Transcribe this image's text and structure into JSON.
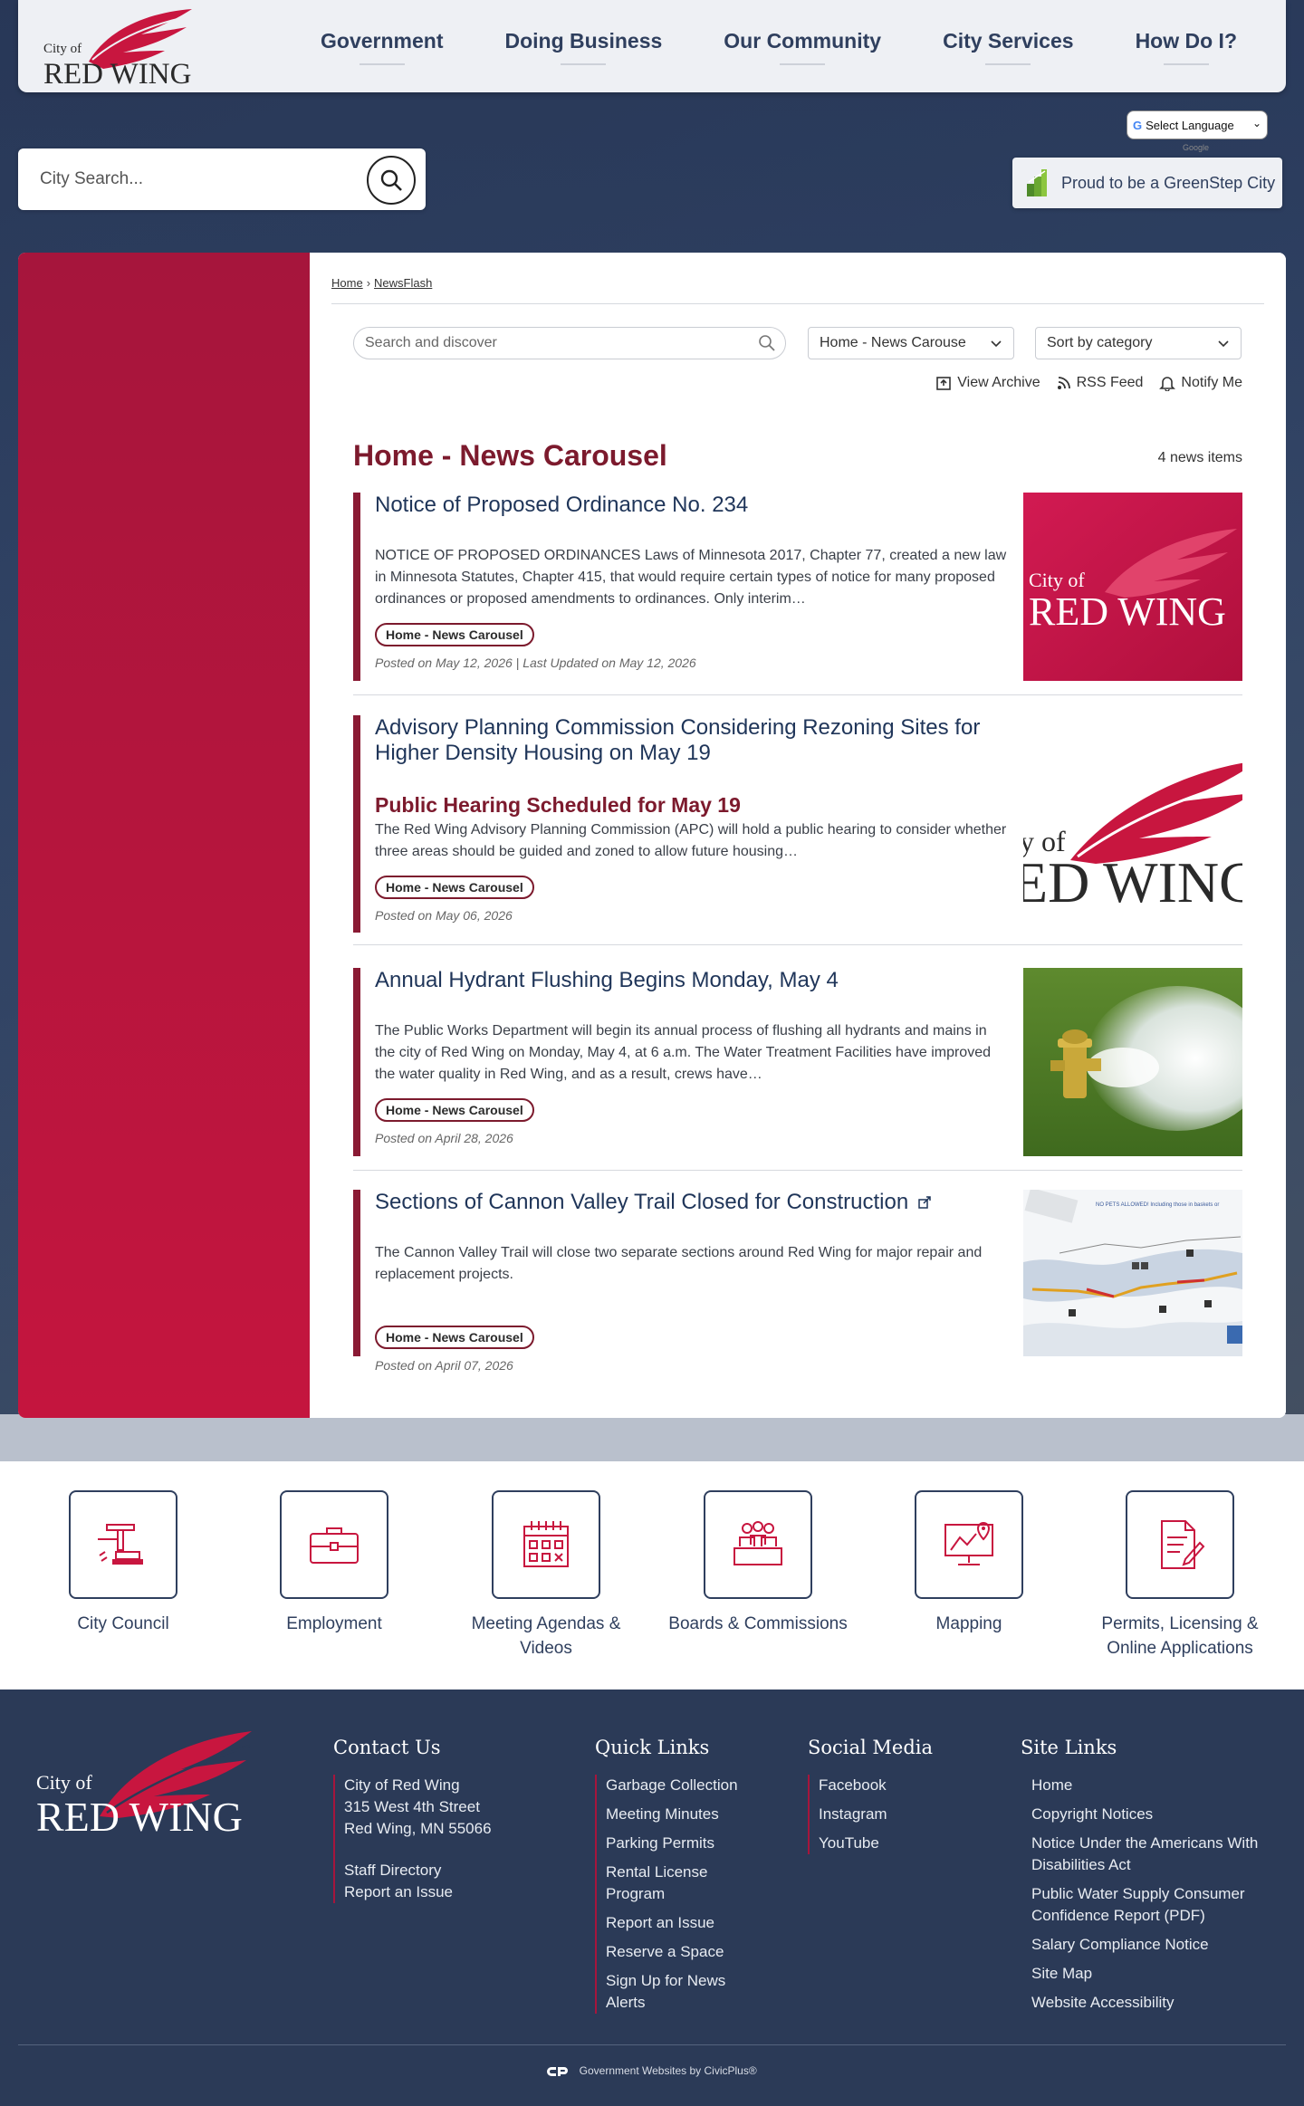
{
  "header": {
    "logo_text_small": "City of",
    "logo_text_large": "RED WING",
    "nav": [
      "Government",
      "Doing Business",
      "Our Community",
      "City Services",
      "How Do I?"
    ]
  },
  "search": {
    "placeholder": "City Search..."
  },
  "translate": {
    "label": "Select Language",
    "powered": "Google"
  },
  "greenstep": {
    "label": "Proud to be a GreenStep City"
  },
  "breadcrumb": {
    "home": "Home",
    "sep": "›",
    "current": "NewsFlash"
  },
  "filters": {
    "search_placeholder": "Search and discover",
    "category_select": "Home - News Carouse",
    "sort_select": "Sort by category"
  },
  "actions": {
    "archive": "View Archive",
    "rss": "RSS Feed",
    "notify": "Notify Me"
  },
  "page": {
    "title": "Home - News Carousel",
    "count": "4 news items"
  },
  "items": [
    {
      "title": "Notice of Proposed Ordinance No. 234",
      "subtitle": "",
      "summary": "NOTICE OF PROPOSED ORDINANCES Laws of Minnesota 2017, Chapter 77, created a new law in Minnesota Statutes, Chapter 415, that would require certain types of notice for many proposed ordinances or proposed amendments to ordinances.  Only interim…",
      "tag": "Home - News Carousel",
      "posted": "Posted on May 12, 2026 | Last Updated on May 12, 2026"
    },
    {
      "title": "Advisory Planning Commission Considering Rezoning Sites for Higher Density Housing on May 19",
      "subtitle": "Public Hearing Scheduled for May 19",
      "summary": "The Red Wing Advisory Planning Commission (APC) will hold a public hearing to consider whether three areas should be guided and zoned to allow future housing…",
      "tag": "Home - News Carousel",
      "posted": "Posted on May 06, 2026"
    },
    {
      "title": "Annual Hydrant Flushing Begins Monday, May 4",
      "subtitle": "",
      "summary": "The Public Works Department will begin its annual process of flushing all hydrants and mains in the city of Red Wing on Monday, May 4, at 6 a.m. The Water Treatment Facilities have improved the water quality in Red Wing, and as a result, crews have…",
      "tag": "Home - News Carousel",
      "posted": "Posted on April 28, 2026"
    },
    {
      "title": "Sections of Cannon Valley Trail Closed for Construction",
      "subtitle": "",
      "summary": "The Cannon Valley Trail will close two separate sections around Red Wing for major repair and replacement projects.",
      "tag": "Home - News Carousel",
      "posted": "Posted on April 07, 2026"
    }
  ],
  "map_thumb": {
    "banner": "NO PETS ALLOWED! Including those in baskets or"
  },
  "quick_links": [
    {
      "label": "City Council",
      "icon": "gavel-icon"
    },
    {
      "label": "Employment",
      "icon": "briefcase-icon"
    },
    {
      "label": "Meeting Agendas & Videos",
      "icon": "calendar-icon"
    },
    {
      "label": "Boards & Commissions",
      "icon": "group-icon"
    },
    {
      "label": "Mapping",
      "icon": "map-monitor-icon"
    },
    {
      "label": "Permits, Licensing & Online Applications",
      "icon": "document-pen-icon"
    }
  ],
  "footer": {
    "contact": {
      "heading": "Contact Us",
      "lines": [
        "City of Red Wing",
        "315 West 4th Street",
        "Red Wing, MN 55066"
      ],
      "links": [
        "Staff Directory",
        "Report an Issue"
      ]
    },
    "quick": {
      "heading": "Quick Links",
      "links": [
        "Garbage Collection",
        "Meeting Minutes",
        "Parking Permits",
        "Rental License Program",
        "Report an Issue",
        "Reserve a Space",
        "Sign Up for News Alerts"
      ]
    },
    "social": {
      "heading": "Social Media",
      "links": [
        "Facebook",
        "Instagram",
        "YouTube"
      ]
    },
    "site": {
      "heading": "Site Links",
      "links": [
        "Home",
        "Copyright Notices",
        "Notice Under the Americans With Disabilities Act",
        "Public Water Supply Consumer Confidence Report (PDF)",
        "Salary Compliance Notice",
        "Site Map",
        "Website Accessibility"
      ]
    },
    "credit": "Government Websites by CivicPlus®"
  },
  "colors": {
    "brand_red": "#a6153c",
    "navy": "#2b3a57",
    "title_red": "#7c1a2d"
  }
}
